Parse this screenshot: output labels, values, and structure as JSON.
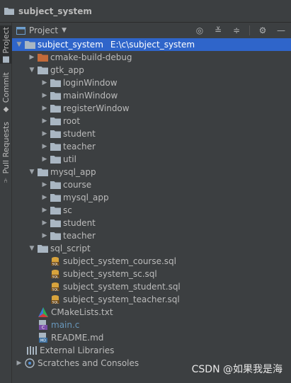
{
  "titlebar": {
    "title": "subject_system"
  },
  "side_tabs": [
    {
      "label": "Project"
    },
    {
      "label": "Commit"
    },
    {
      "label": "Pull Requests"
    }
  ],
  "toolbar": {
    "view_label": "Project"
  },
  "tree": {
    "root": {
      "name": "subject_system",
      "path": "E:\\c\\subject_system"
    },
    "cmake_build_debug": "cmake-build-debug",
    "gtk_app": {
      "name": "gtk_app",
      "children": [
        "loginWindow",
        "mainWindow",
        "registerWindow",
        "root",
        "student",
        "teacher",
        "util"
      ]
    },
    "mysql_app": {
      "name": "mysql_app",
      "children": [
        "course",
        "mysql_app",
        "sc",
        "student",
        "teacher"
      ]
    },
    "sql_script": {
      "name": "sql_script",
      "files": [
        "subject_system_course.sql",
        "subject_system_sc.sql",
        "subject_system_student.sql",
        "subject_system_teacher.sql"
      ]
    },
    "files": {
      "cmakelists": "CMakeLists.txt",
      "main_c": "main.c",
      "readme": "README.md"
    },
    "external_libraries": "External Libraries",
    "scratches": "Scratches and Consoles"
  },
  "watermark": "CSDN @如果我是海",
  "colors": {
    "selection": "#2f65ca",
    "folder": "#a9b6c2",
    "excluded_folder": "#c26a3a",
    "c_file": "#6897bb"
  }
}
